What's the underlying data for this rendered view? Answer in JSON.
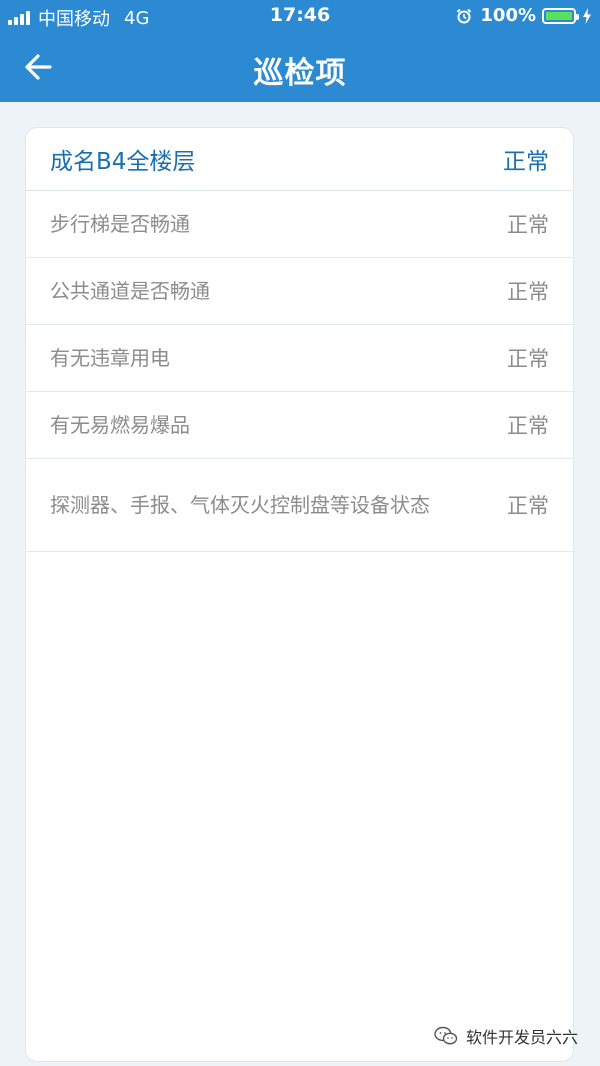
{
  "status_bar": {
    "carrier": "中国移动",
    "network": "4G",
    "time": "17:46",
    "battery_percent": "100%",
    "battery_level": 1.0,
    "battery_color": "#5be05b"
  },
  "nav": {
    "title": "巡检项",
    "back_icon": "arrow-left-icon",
    "background_color": "#2b8ad1"
  },
  "group": {
    "title": "成名B4全楼层",
    "status": "正常",
    "items": [
      {
        "label": "步行梯是否畅通",
        "status": "正常"
      },
      {
        "label": "公共通道是否畅通",
        "status": "正常"
      },
      {
        "label": "有无违章用电",
        "status": "正常"
      },
      {
        "label": "有无易燃易爆品",
        "status": "正常"
      },
      {
        "label": "探测器、手报、气体灭火控制盘等设备状态",
        "status": "正常"
      }
    ]
  },
  "watermark": {
    "text": "软件开发员六六",
    "icon": "wechat-icon"
  }
}
